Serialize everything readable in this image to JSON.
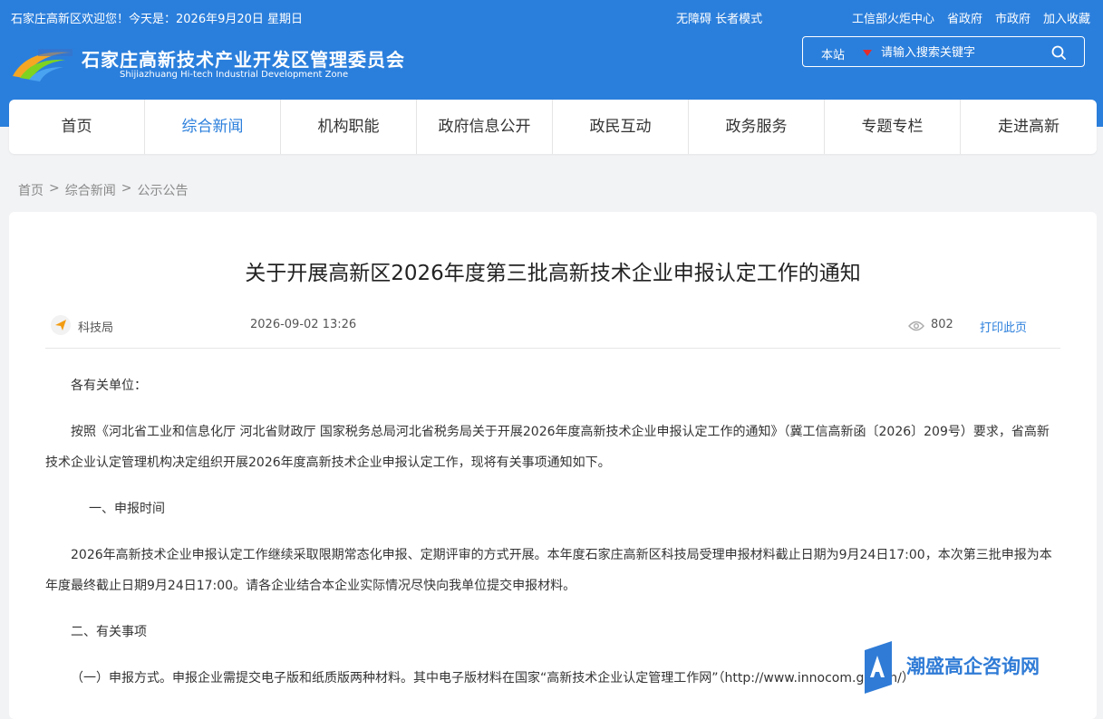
{
  "header": {
    "welcome": "石家庄高新区欢迎您！今天是：2026年9月20日  星期日",
    "accessibility": "无障碍 长者模式",
    "links": [
      "工信部火炬中心",
      "省政府",
      "市政府",
      "加入收藏"
    ],
    "site_name": "石家庄高新技术产业开发区管理委员会",
    "site_name_en": "Shijiazhuang Hi-tech Industrial Development Zone",
    "search": {
      "scope": "本站",
      "placeholder": "请输入搜索关键字"
    }
  },
  "nav": {
    "items": [
      "首页",
      "综合新闻",
      "机构职能",
      "政府信息公开",
      "政民互动",
      "政务服务",
      "专题专栏",
      "走进高新"
    ],
    "active": "综合新闻"
  },
  "breadcrumb": [
    "首页",
    ">",
    "综合新闻",
    ">",
    "公示公告"
  ],
  "article": {
    "title": "关于开展高新区2026年度第三批高新技术企业申报认定工作的通知",
    "department": "科技局",
    "date": "2026-09-02 13:26",
    "views": "802",
    "print_label": "打印此页",
    "paragraphs": [
      "各有关单位：",
      "按照《河北省工业和信息化厅 河北省财政厅 国家税务总局河北省税务局关于开展2026年度高新技术企业申报认定工作的通知》（冀工信高新函〔2026〕209号）要求，省高新技术企业认定管理机构决定组织开展2026年度高新技术企业申报认定工作，现将有关事项通知如下。",
      "一、申报时间",
      "2026年高新技术企业申报认定工作继续采取限期常态化申报、定期评审的方式开展。本年度石家庄高新区科技局受理申报材料截止日期为9月24日17:00，本次第三批申报为本年度最终截止日期9月24日17:00。请各企业结合本企业实际情况尽快向我单位提交申报材料。",
      "二、有关事项",
      "（一）申报方式。申报企业需提交电子版和纸质版两种材料。其中电子版材料在国家“高新技术企业认定管理工作网”（http://www.innocom.gov.cn/）"
    ]
  },
  "watermark": {
    "text": "潮盛高企咨询网"
  },
  "colors": {
    "brand_blue": "#2b7fdc",
    "caret_red": "#e32c2c"
  }
}
